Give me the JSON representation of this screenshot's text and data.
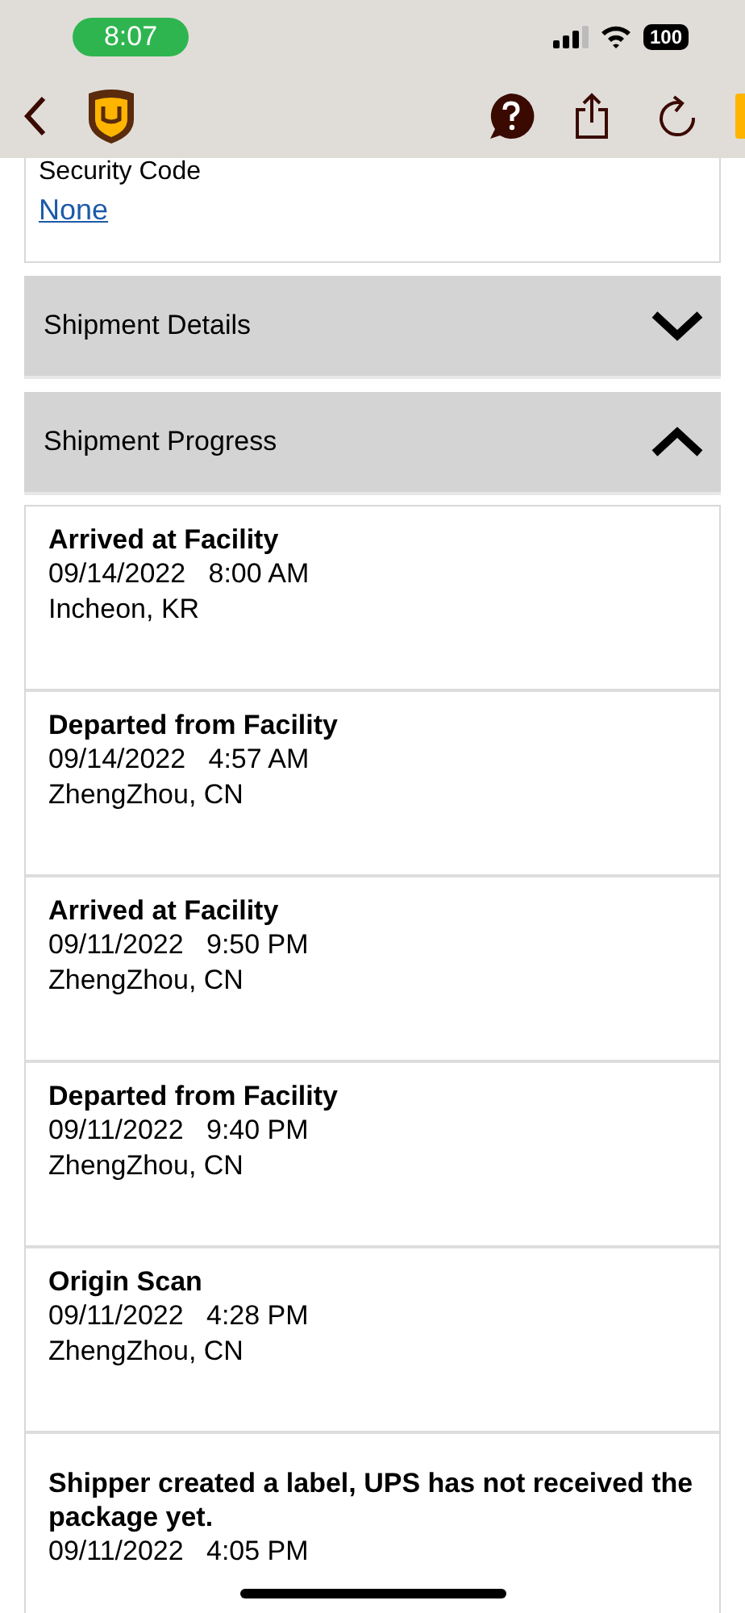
{
  "status_bar": {
    "time": "8:07",
    "battery": "100"
  },
  "security_code": {
    "label": "Security Code",
    "value": "None"
  },
  "sections": [
    {
      "title": "Shipment Details",
      "expanded": false
    },
    {
      "title": "Shipment Progress",
      "expanded": true
    }
  ],
  "events": [
    {
      "status": "Arrived at Facility",
      "date": "09/14/2022",
      "time": "8:00 AM",
      "location": "Incheon, KR"
    },
    {
      "status": "Departed from Facility",
      "date": "09/14/2022",
      "time": "4:57 AM",
      "location": "ZhengZhou, CN"
    },
    {
      "status": "Arrived at Facility",
      "date": "09/11/2022",
      "time": "9:50 PM",
      "location": "ZhengZhou, CN"
    },
    {
      "status": "Departed from Facility",
      "date": "09/11/2022",
      "time": "9:40 PM",
      "location": "ZhengZhou, CN"
    },
    {
      "status": "Origin Scan",
      "date": "09/11/2022",
      "time": "4:28 PM",
      "location": "ZhengZhou, CN"
    },
    {
      "status": "Shipper created a label, UPS has not received the package yet.",
      "date": "09/11/2022",
      "time": "4:05 PM"
    }
  ]
}
